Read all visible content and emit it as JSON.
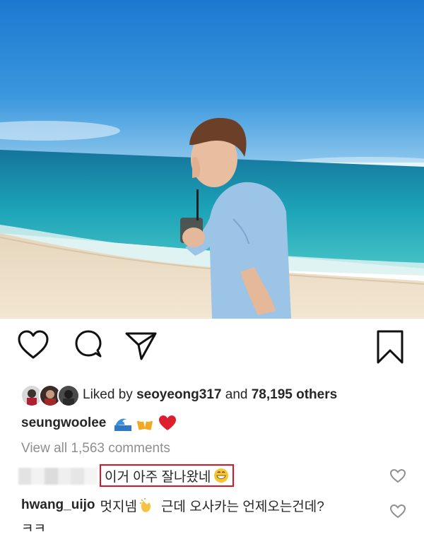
{
  "post": {
    "likes": {
      "prefix": "Liked by",
      "username": "seoyeong317",
      "middle": "and",
      "count": "78,195 others"
    },
    "caption": {
      "username": "seungwoolee",
      "emojis": [
        "wave-emoji",
        "beer-mugs-emoji",
        "red-heart-emoji"
      ]
    },
    "view_all": "View all 1,563 comments",
    "comments": [
      {
        "username": "",
        "text": "이거 아주 잘나왔네",
        "emoji": "grinning-face-emoji"
      },
      {
        "username": "hwang_uijo",
        "text_a": "멋지넴",
        "emoji": "clapping-hands-emoji",
        "text_b": "근데 오사카는 언제오는건데?",
        "text_c": "ㅋㅋ"
      }
    ]
  },
  "colors": {
    "sky_top": "#1d7fd2",
    "sea": "#1fa8c0",
    "sand": "#efe0c8",
    "highlight_border": "#e0141e",
    "muted_text": "#8e8e8e"
  }
}
